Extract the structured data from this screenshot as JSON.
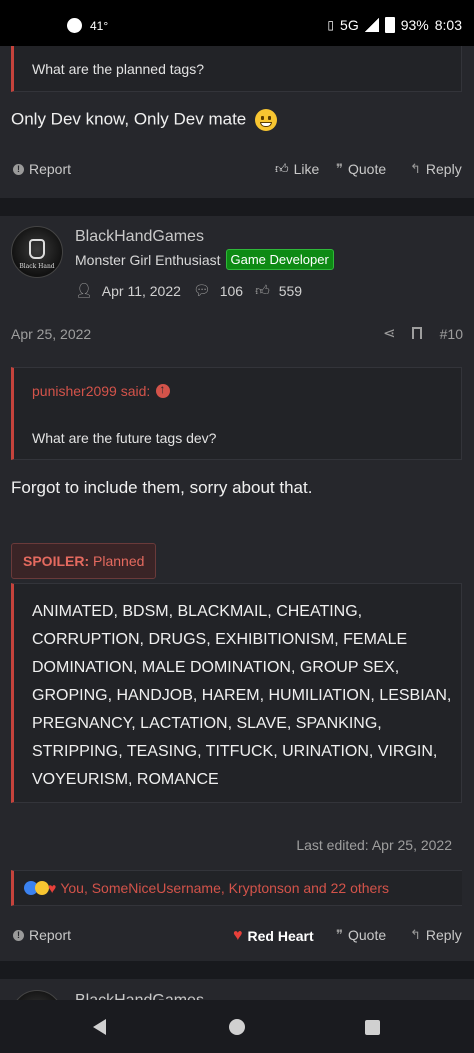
{
  "status_bar": {
    "temperature": "41°",
    "network": "5G",
    "battery": "93%",
    "time": "8:03"
  },
  "post_top": {
    "quote_text": "What are the planned tags?",
    "message": "Only Dev know, Only Dev mate",
    "actions": {
      "report": "Report",
      "like": "Like",
      "quote": "Quote",
      "reply": "Reply"
    }
  },
  "post_main": {
    "author": {
      "name": "BlackHandGames",
      "title": "Monster Girl Enthusiast",
      "badge": "Game Developer",
      "joined": "Apr 11, 2022",
      "messages": "106",
      "reactions": "559",
      "avatar_text": "Black Hand"
    },
    "date": "Apr 25, 2022",
    "number": "#10",
    "quote": {
      "author": "punisher2099 said:",
      "text": "What are the future tags dev?"
    },
    "message": "Forgot to include them, sorry about that.",
    "spoiler": {
      "label_bold": "SPOILER:",
      "label_title": "Planned",
      "content": "ANIMATED, BDSM, BLACKMAIL, CHEATING, CORRUPTION, DRUGS, EXHIBITIONISM, FEMALE DOMINATION, MALE DOMINATION, GROUP SEX, GROPING, HANDJOB, HAREM, HUMILIATION, LESBIAN, PREGNANCY, LACTATION, SLAVE, SPANKING, STRIPPING, TEASING, TITFUCK, URINATION, VIRGIN, VOYEURISM, ROMANCE"
    },
    "last_edited": "Last edited: Apr 25, 2022",
    "reactions_text": "You, SomeNiceUsername, Kryptonson and 22 others",
    "actions": {
      "report": "Report",
      "reaction": "Red Heart",
      "quote": "Quote",
      "reply": "Reply"
    }
  },
  "post_next": {
    "author_name": "BlackHandGames"
  },
  "colors": {
    "accent": "#c5433c",
    "badge_green": "#0e8a14",
    "heart": "#e8403a"
  }
}
